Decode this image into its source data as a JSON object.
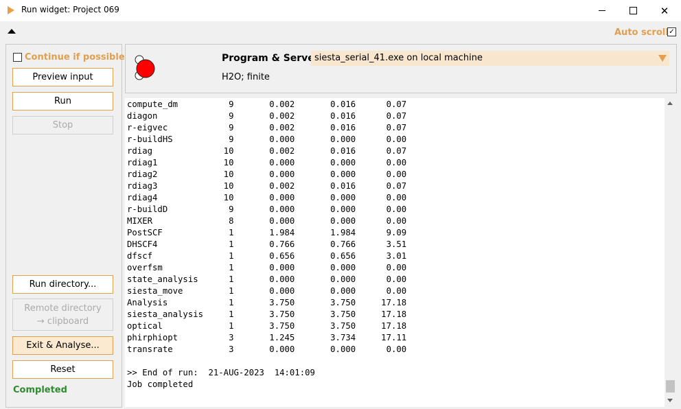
{
  "window": {
    "title": "Run widget: Project 069",
    "close_glyph": "✕",
    "icon": "play-triangle-icon"
  },
  "toolbar": {
    "auto_scroll_label": "Auto scroll",
    "auto_scroll_checked": true,
    "check_glyph": "✓"
  },
  "sidebar": {
    "continue_label": "Continue if possible",
    "continue_checked": false,
    "buttons": {
      "preview": "Preview input",
      "run": "Run",
      "stop": "Stop",
      "run_directory": "Run directory...",
      "remote_line1": "Remote directory",
      "remote_line2": "→ clipboard",
      "exit_analyse": "Exit & Analyse...",
      "reset": "Reset"
    },
    "status": "Completed"
  },
  "header": {
    "program_label": "Program & Server",
    "program_value": "siesta_serial_41.exe on local machine",
    "system": "H2O; finite"
  },
  "output": {
    "lines": [
      "compute_dm          9       0.002       0.016      0.07",
      "diagon              9       0.002       0.016      0.07",
      "r-eigvec            9       0.002       0.016      0.07",
      "r-buildHS           9       0.000       0.000      0.00",
      "rdiag              10       0.002       0.016      0.07",
      "rdiag1             10       0.000       0.000      0.00",
      "rdiag2             10       0.000       0.000      0.00",
      "rdiag3             10       0.002       0.016      0.07",
      "rdiag4             10       0.000       0.000      0.00",
      "r-buildD            9       0.000       0.000      0.00",
      "MIXER               8       0.000       0.000      0.00",
      "PostSCF             1       1.984       1.984      9.09",
      "DHSCF4              1       0.766       0.766      3.51",
      "dfscf               1       0.656       0.656      3.01",
      "overfsm             1       0.000       0.000      0.00",
      "state_analysis      1       0.000       0.000      0.00",
      "siesta_move         1       0.000       0.000      0.00",
      "Analysis            1       3.750       3.750     17.18",
      "siesta_analysis     1       3.750       3.750     17.18",
      "optical             1       3.750       3.750     17.18",
      "phirphiopt          3       1.245       3.734     17.11",
      "transrate           3       0.000       0.000      0.00",
      "",
      ">> End of run:  21-AUG-2023  14:01:09",
      "Job completed"
    ]
  },
  "colors": {
    "accent": "#e0a050",
    "status_ok": "#2e8b2e",
    "oxygen": "#ff0000",
    "hydrogen": "#ffffff"
  }
}
